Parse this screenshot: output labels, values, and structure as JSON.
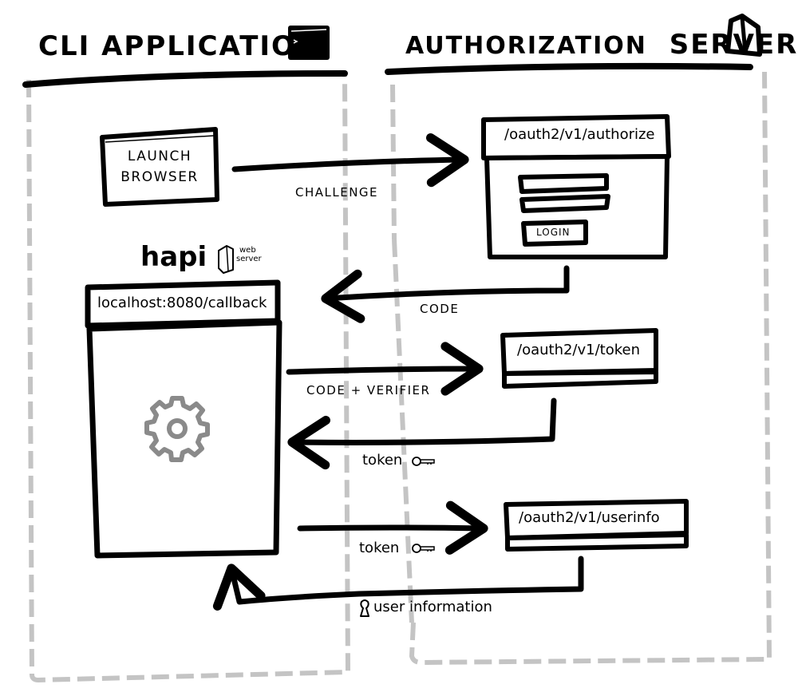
{
  "diagram": {
    "type": "sequence",
    "colors": {
      "ink": "#000000",
      "lane_border": "#c4c4c4",
      "gear": "#8a8a8a",
      "background": "#ffffff"
    },
    "lanes": {
      "cli": {
        "title": "CLI APPLICATION",
        "icon": "terminal-icon",
        "terminal_prompt": ">"
      },
      "auth_server": {
        "title_part1": "AUTHORIZATION",
        "title_part2": "SERVER",
        "icon": "server-icon"
      }
    },
    "nodes": {
      "launch_browser": {
        "line1": "LAUNCH",
        "line2": "BROWSER"
      },
      "authorize_page": {
        "url": "/oauth2/v1/authorize",
        "login_button": "LOGIN"
      },
      "hapi": {
        "name": "hapi",
        "badge_line1": "web",
        "badge_line2": "server",
        "icon": "server-icon"
      },
      "callback_window": {
        "url": "localhost:8080/callback",
        "icon": "gear-icon"
      },
      "token_endpoint": {
        "url": "/oauth2/v1/token"
      },
      "userinfo_endpoint": {
        "url": "/oauth2/v1/userinfo"
      }
    },
    "messages": [
      {
        "from": "launch_browser",
        "to": "authorize_page",
        "label": "CHALLENGE",
        "icon": null
      },
      {
        "from": "authorize_page",
        "to": "callback_window",
        "label": "CODE",
        "icon": null
      },
      {
        "from": "callback_window",
        "to": "token_endpoint",
        "label": "CODE + VERIFIER",
        "icon": null
      },
      {
        "from": "token_endpoint",
        "to": "callback_window",
        "label": "token",
        "icon": "key-icon"
      },
      {
        "from": "callback_window",
        "to": "userinfo_endpoint",
        "label": "token",
        "icon": "key-icon"
      },
      {
        "from": "userinfo_endpoint",
        "to": "callback_window",
        "label": "user information",
        "icon": "user-icon"
      }
    ]
  }
}
